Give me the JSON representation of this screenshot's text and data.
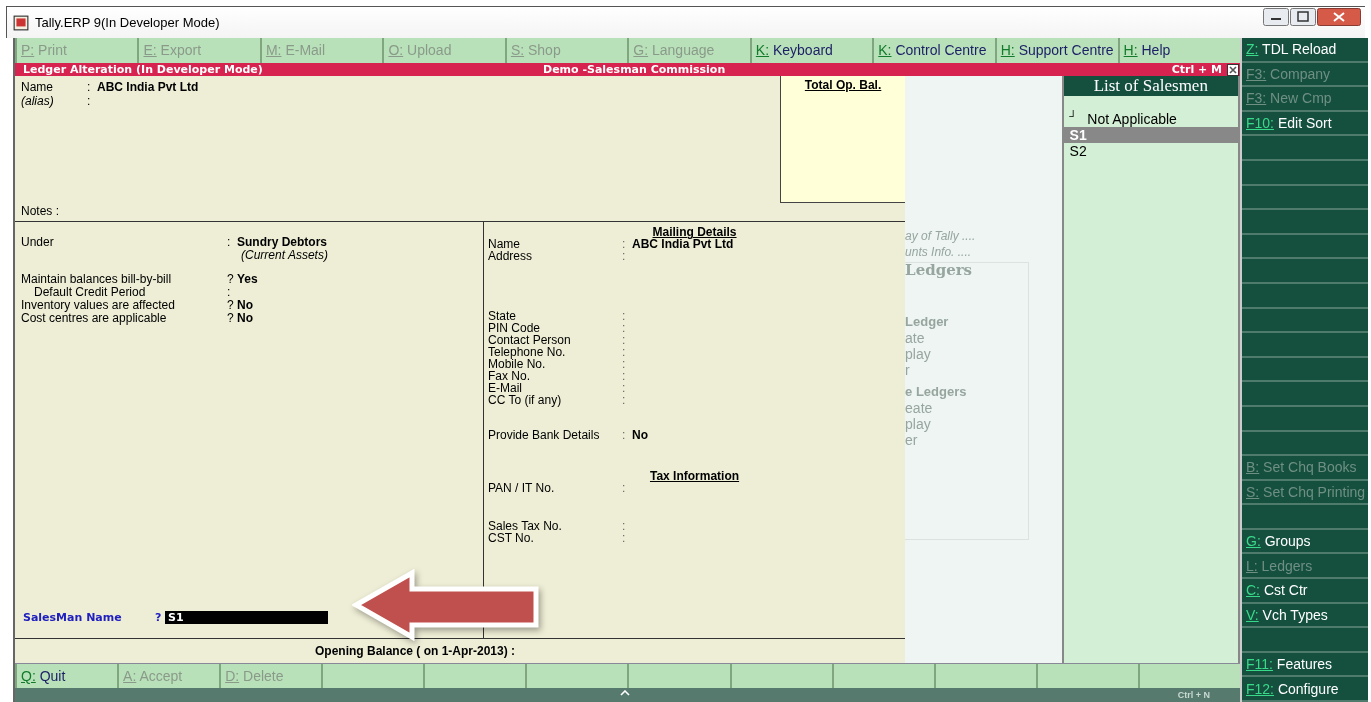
{
  "window": {
    "title": "Tally.ERP 9(In Developer Mode)"
  },
  "top_buttons": [
    {
      "key": "P:",
      "label": "Print",
      "disabled": true
    },
    {
      "key": "E:",
      "label": "Export",
      "disabled": true
    },
    {
      "key": "M:",
      "label": "E-Mail",
      "disabled": true
    },
    {
      "key": "O:",
      "label": "Upload",
      "disabled": true
    },
    {
      "key": "S:",
      "label": "Shop",
      "disabled": true
    },
    {
      "key": "G:",
      "label": "Language",
      "disabled": true
    },
    {
      "key": "K:",
      "label": "Keyboard",
      "disabled": false
    },
    {
      "key": "K:",
      "label": "Control Centre",
      "disabled": false
    },
    {
      "key": "H:",
      "label": "Support Centre",
      "disabled": false
    },
    {
      "key": "H:",
      "label": "Help",
      "disabled": false
    }
  ],
  "header": {
    "title": "Ledger Alteration (In Developer Mode)",
    "company": "Demo -Salesman Commission",
    "shortcut": "Ctrl + M"
  },
  "form": {
    "name_label": "Name",
    "name_sep": ":",
    "name_value": "ABC India Pvt Ltd",
    "alias_label": "(alias)",
    "alias_sep": ":",
    "notes_label": "Notes :",
    "total_op_bal": "Total Op. Bal.",
    "left_fields": [
      {
        "label": "Under",
        "sep": ":",
        "value": "Sundry Debtors",
        "note": "(Current Assets)",
        "kind": "field"
      },
      {
        "label": "Maintain balances bill-by-bill",
        "sep": "?",
        "value": "Yes",
        "kind": "field"
      },
      {
        "label": "Default Credit Period",
        "sep": ":",
        "kind": "indented"
      },
      {
        "label": "Inventory values are affected",
        "sep": "?",
        "value": "No",
        "kind": "field"
      },
      {
        "label": "Cost centres are applicable",
        "sep": "?",
        "value": "No",
        "kind": "field"
      }
    ],
    "mailing": {
      "heading": "Mailing Details",
      "groups": [
        [
          {
            "label": "Name",
            "sep": ":",
            "value": "ABC India Pvt Ltd"
          },
          {
            "label": "Address",
            "sep": ":"
          }
        ],
        [
          {
            "label": "State",
            "sep": ":"
          },
          {
            "label": "PIN Code",
            "sep": ":"
          },
          {
            "label": "Contact Person",
            "sep": ":"
          },
          {
            "label": "Telephone No.",
            "sep": ":"
          },
          {
            "label": "Mobile No.",
            "sep": ":"
          },
          {
            "label": "Fax No.",
            "sep": ":"
          },
          {
            "label": "E-Mail",
            "sep": ":"
          },
          {
            "label": "CC To (if any)",
            "sep": ":"
          }
        ],
        [
          {
            "label": "Provide Bank Details",
            "sep": ":",
            "value": "No"
          }
        ]
      ]
    },
    "tax": {
      "heading": "Tax Information",
      "groups": [
        [
          {
            "label": "PAN / IT No.",
            "sep": ":"
          }
        ],
        [
          {
            "label": "Sales Tax No.",
            "sep": ":"
          },
          {
            "label": "CST No.",
            "sep": ":"
          }
        ]
      ]
    },
    "salesman": {
      "label": "SalesMan Name",
      "sep": "?",
      "value": "S1"
    },
    "opening_balance": "Opening Balance ( on 1-Apr-2013) :"
  },
  "background_menu": [
    {
      "text": "ay of Tally ....",
      "kind": "italic"
    },
    {
      "text": "unts Info. ....",
      "kind": "italic"
    },
    {
      "text": "Ledgers",
      "kind": "heading"
    },
    {
      "text": "Ledger",
      "kind": "bold"
    },
    {
      "text": "ate",
      "kind": "plain"
    },
    {
      "text": "play",
      "kind": "plain"
    },
    {
      "text": "r",
      "kind": "plain"
    },
    {
      "text": "e Ledgers",
      "kind": "bold"
    },
    {
      "text": "eate",
      "kind": "plain"
    },
    {
      "text": "play",
      "kind": "plain"
    },
    {
      "text": "er",
      "kind": "plain"
    }
  ],
  "salesmen_list": {
    "title": "List of Salesmen",
    "items": [
      {
        "marker": "┘",
        "label": "Not Applicable",
        "selected": false
      },
      {
        "label": "S1",
        "selected": true
      },
      {
        "label": "S2",
        "selected": false
      }
    ]
  },
  "side_buttons": [
    {
      "key": "Z:",
      "label": "TDL Reload",
      "disabled": false
    },
    {
      "key": "F3:",
      "label": "Company",
      "disabled": true
    },
    {
      "key": "F3:",
      "label": "New Cmp",
      "disabled": true
    },
    {
      "key": "F10:",
      "label": "Edit Sort",
      "disabled": false
    },
    {
      "kind": "empty"
    },
    {
      "kind": "empty"
    },
    {
      "kind": "empty"
    },
    {
      "kind": "empty"
    },
    {
      "kind": "empty"
    },
    {
      "kind": "empty"
    },
    {
      "kind": "empty"
    },
    {
      "kind": "empty"
    },
    {
      "kind": "empty"
    },
    {
      "kind": "empty"
    },
    {
      "kind": "empty"
    },
    {
      "kind": "empty"
    },
    {
      "kind": "empty"
    },
    {
      "key": "B:",
      "label": "Set Chq Books",
      "disabled": true
    },
    {
      "key": "S:",
      "label": "Set Chq Printing",
      "disabled": true
    },
    {
      "kind": "empty"
    },
    {
      "key": "G:",
      "label": "Groups",
      "disabled": false
    },
    {
      "key": "L:",
      "label": "Ledgers",
      "disabled": true
    },
    {
      "key": "C:",
      "label": "Cst Ctr",
      "disabled": false
    },
    {
      "key": "V:",
      "label": "Vch Types",
      "disabled": false
    },
    {
      "kind": "empty"
    },
    {
      "key": "F11:",
      "label": "Features",
      "disabled": false
    },
    {
      "key": "F12:",
      "label": "Configure",
      "disabled": false
    }
  ],
  "bottom_buttons": [
    {
      "key": "Q:",
      "label": "Quit",
      "disabled": false
    },
    {
      "key": "A:",
      "label": "Accept",
      "disabled": true
    },
    {
      "key": "D:",
      "label": "Delete",
      "disabled": true
    },
    {
      "kind": "empty"
    },
    {
      "kind": "empty"
    },
    {
      "kind": "empty"
    },
    {
      "kind": "empty"
    },
    {
      "kind": "empty"
    },
    {
      "kind": "empty"
    },
    {
      "kind": "empty"
    },
    {
      "kind": "empty"
    },
    {
      "kind": "empty"
    }
  ],
  "footer": {
    "shortcut": "Ctrl + N"
  }
}
